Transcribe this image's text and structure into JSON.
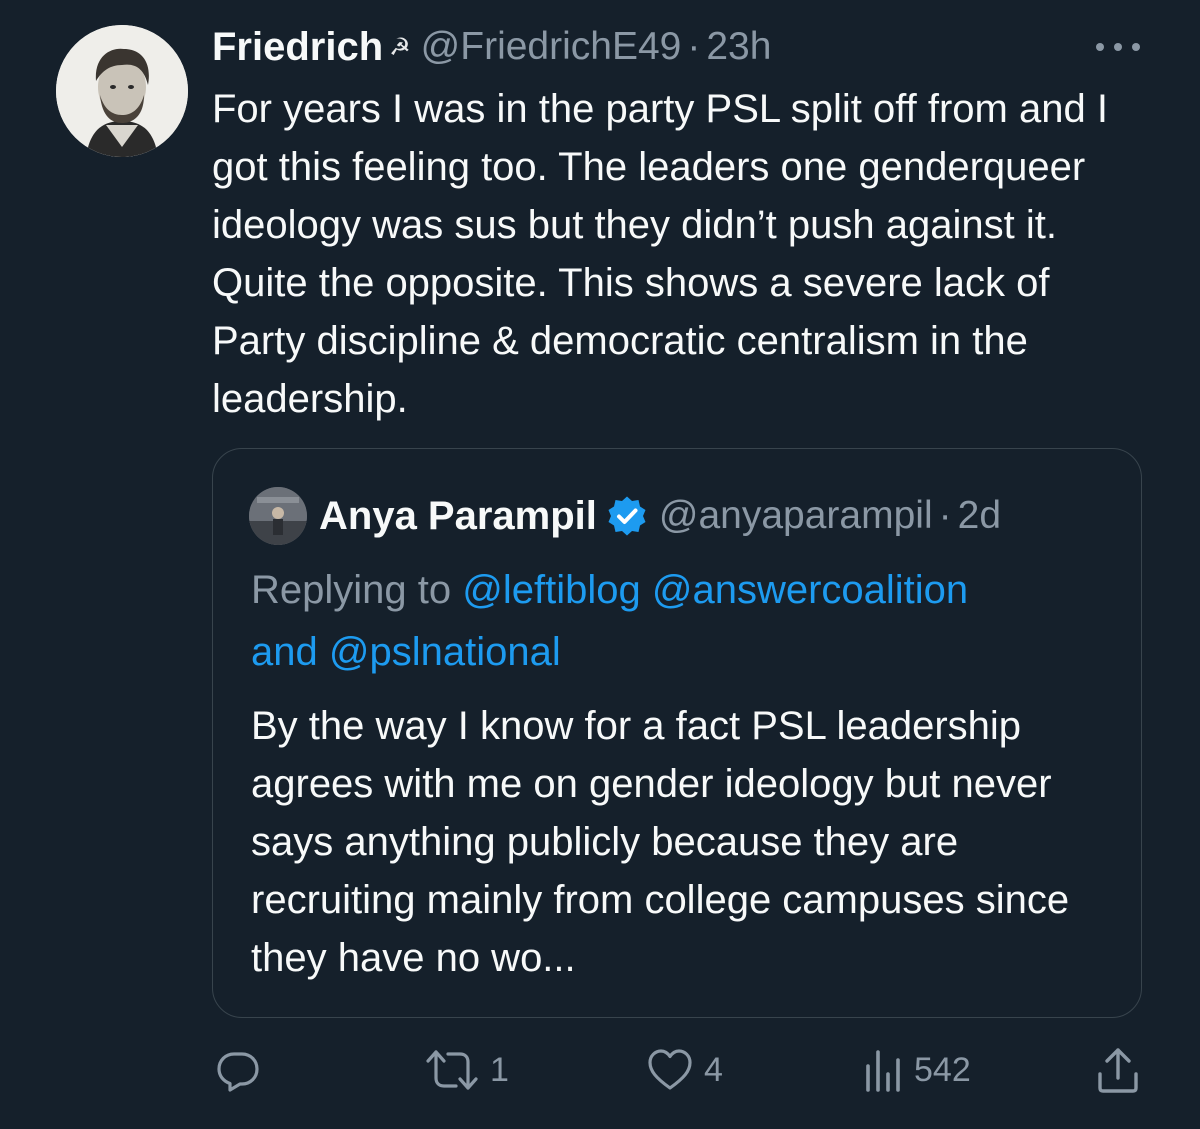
{
  "tweet": {
    "author_name": "Friedrich",
    "author_emoji": "☭",
    "author_handle": "@FriedrichE49",
    "separator": "·",
    "time": "23h",
    "text": "For years I was in the party PSL split off from and I got this feeling too. The leaders one genderqueer ideology was sus but they didn’t push against it. Quite the opposite. This shows a severe lack of Party discipline & democratic centralism in the leadership."
  },
  "quoted_tweet": {
    "author_name": "Anya Parampil",
    "author_handle": "@anyaparampil",
    "separator": "·",
    "time": "2d",
    "replying_prefix": "Replying to ",
    "mention_1": "@leftiblog",
    "mention_2": "@answercoalition",
    "replying_and": "and ",
    "mention_3": "@pslnational",
    "text": "By the way I know for a fact PSL leadership agrees with me on gender ideology but never says anything publicly because they are recruiting mainly from college campuses since they have no wo..."
  },
  "actions": {
    "reply_count": "",
    "retweet_count": "1",
    "like_count": "4",
    "views_count": "542"
  },
  "icons": {
    "more": "more-horizontal-icon",
    "verified": "verified-badge-icon",
    "reply": "reply-icon",
    "retweet": "retweet-icon",
    "like": "heart-icon",
    "views": "views-icon",
    "share": "share-icon"
  },
  "colors": {
    "background": "#15202b",
    "text_primary": "#f7f9f9",
    "text_secondary": "#8b98a5",
    "accent": "#1d9bf0",
    "border": "#38444d"
  }
}
